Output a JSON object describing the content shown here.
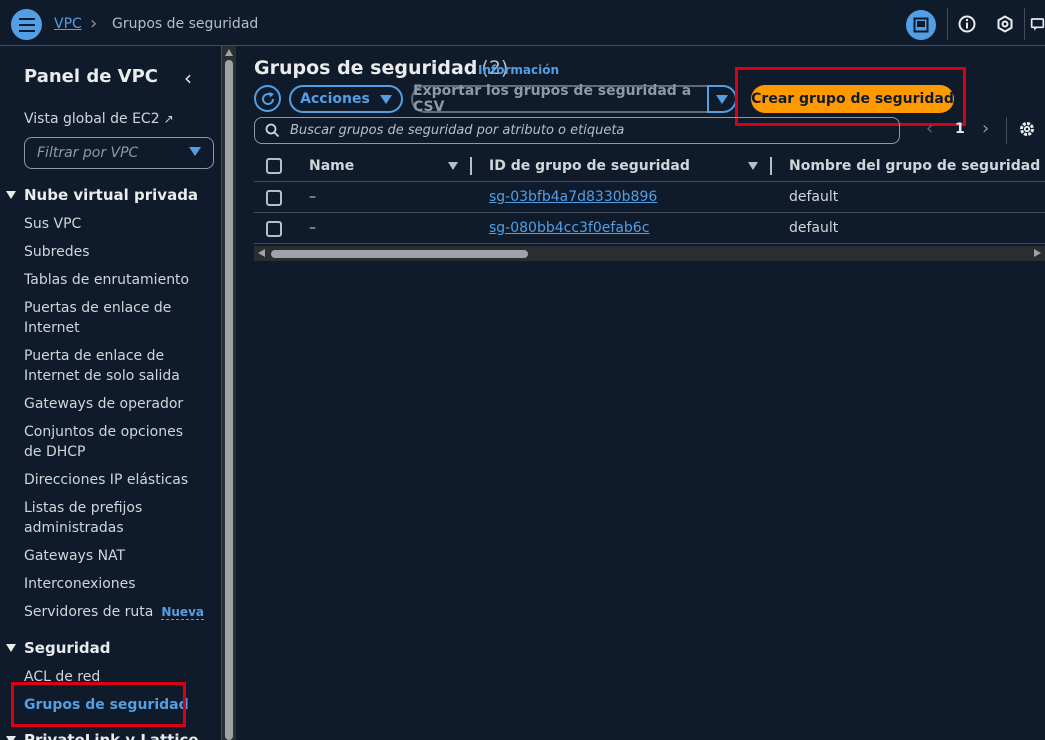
{
  "header": {
    "breadcrumb": {
      "root": "VPC",
      "separator": "›",
      "current": "Grupos de seguridad"
    }
  },
  "sidebar": {
    "title": "Panel de VPC",
    "ec2_link": "Vista global de EC2",
    "filter_placeholder": "Filtrar por VPC",
    "section_vpc": "Nube virtual privada",
    "vpc_items": [
      "Sus VPC",
      "Subredes",
      "Tablas de enrutamiento",
      "Puertas de enlace de Internet",
      "Puerta de enlace de Internet de solo salida",
      "Gateways de operador",
      "Conjuntos de opciones de DHCP",
      "Direcciones IP elásticas",
      "Listas de prefijos administradas",
      "Gateways NAT",
      "Interconexiones",
      "Servidores de ruta"
    ],
    "new_badge": "Nueva",
    "section_security": "Seguridad",
    "security_items": [
      "ACL de red",
      "Grupos de seguridad"
    ],
    "section_privatelink": "PrivateLink y Lattice"
  },
  "main": {
    "title": "Grupos de seguridad",
    "count": "(2)",
    "info_link": "Información",
    "actions_label": "Acciones",
    "export_label": "Exportar los grupos de seguridad a CSV",
    "create_label": "Crear grupo de seguridad",
    "search_placeholder": "Buscar grupos de seguridad por atributo o etiqueta",
    "page_number": "1",
    "table": {
      "columns": [
        "Name",
        "ID de grupo de seguridad",
        "Nombre del grupo de seguridad"
      ],
      "rows": [
        {
          "name": "–",
          "id": "sg-03bfb4a7d8330b896",
          "group_name": "default"
        },
        {
          "name": "–",
          "id": "sg-080bb4cc3f0efab6c",
          "group_name": "default"
        }
      ]
    }
  },
  "colors": {
    "accent": "#539fe5",
    "primary_button": "#ff9900",
    "highlight": "#d90013",
    "background": "#0f1b2a"
  }
}
